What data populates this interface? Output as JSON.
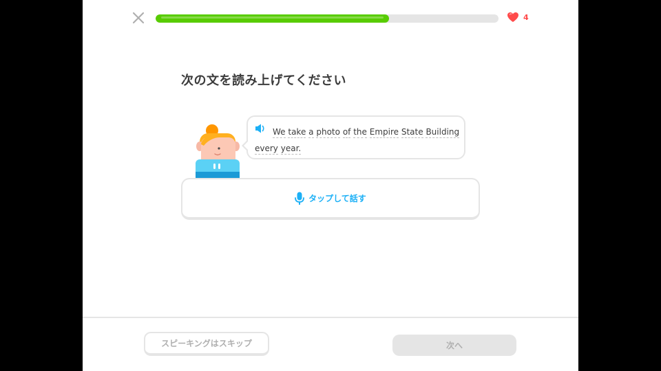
{
  "header": {
    "progress_fraction": 0.68,
    "progress_color": "#58cc02",
    "hearts_count": "4",
    "close_icon": "close-icon",
    "heart_icon": "heart-icon"
  },
  "challenge": {
    "instruction": "次の文を読み上げてください",
    "sentence_words": [
      "We",
      "take",
      "a",
      "photo",
      "of",
      "the",
      "Empire",
      "State",
      "Building",
      "every",
      "year."
    ],
    "speaker_icon": "speaker-icon",
    "tap_to_speak_label": "タップして話す",
    "mic_icon": "microphone-icon"
  },
  "footer": {
    "skip_label": "スピーキングはスキップ",
    "next_label": "次へ"
  },
  "colors": {
    "accent_blue": "#1cb0f6",
    "heart_red": "#ff4b4b",
    "border_gray": "#e5e5e5"
  }
}
